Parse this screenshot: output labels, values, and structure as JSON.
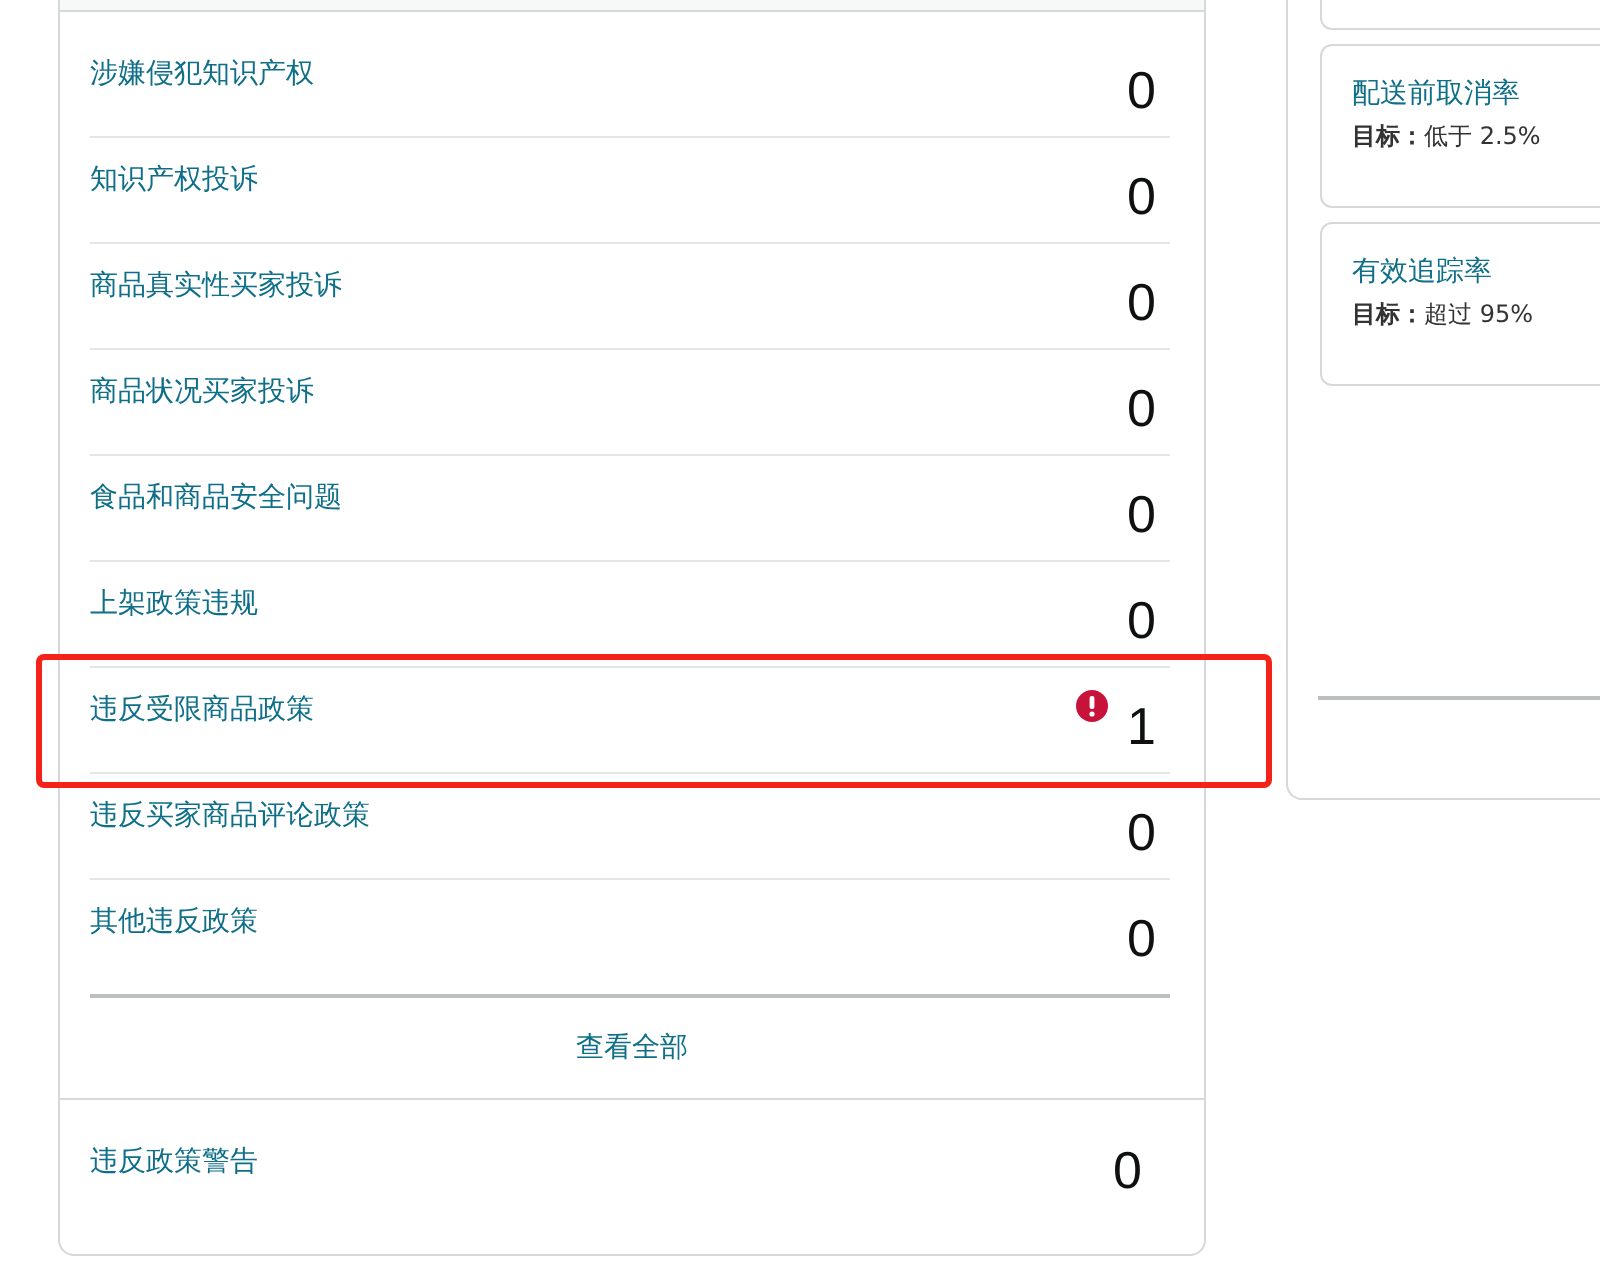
{
  "violations": [
    {
      "label": "涉嫌侵犯知识产权",
      "count": "0",
      "alert": false,
      "highlighted": false
    },
    {
      "label": "知识产权投诉",
      "count": "0",
      "alert": false,
      "highlighted": false
    },
    {
      "label": "商品真实性买家投诉",
      "count": "0",
      "alert": false,
      "highlighted": false
    },
    {
      "label": "商品状况买家投诉",
      "count": "0",
      "alert": false,
      "highlighted": false
    },
    {
      "label": "食品和商品安全问题",
      "count": "0",
      "alert": false,
      "highlighted": false
    },
    {
      "label": "上架政策违规",
      "count": "0",
      "alert": false,
      "highlighted": false
    },
    {
      "label": "违反受限商品政策",
      "count": "1",
      "alert": true,
      "highlighted": true
    },
    {
      "label": "违反买家商品评论政策",
      "count": "0",
      "alert": false,
      "highlighted": false
    },
    {
      "label": "其他违反政策",
      "count": "0",
      "alert": false,
      "highlighted": false
    }
  ],
  "view_all": "查看全部",
  "warnings": {
    "label": "违反政策警告",
    "count": "0"
  },
  "metrics": [
    {
      "title": "配送前取消率",
      "target_label": "目标：",
      "target_value": "低于 2.5%"
    },
    {
      "title": "有效追踪率",
      "target_label": "目标：",
      "target_value": "超过 95%"
    }
  ]
}
